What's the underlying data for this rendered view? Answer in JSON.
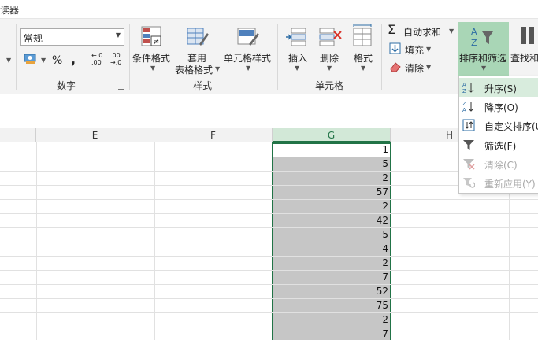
{
  "title_fragment": "读器",
  "ribbon": {
    "number_format": {
      "value": "常规",
      "percent": "%",
      "comma": ",",
      "inc_decimal": "←.0\n.00",
      "dec_decimal": ".00\n→.0",
      "group_label": "数字"
    },
    "styles": {
      "conditional": "条件格式",
      "table1": "套用",
      "table2": "表格格式",
      "cell_style": "单元格样式",
      "group_label": "样式"
    },
    "cells": {
      "insert": "插入",
      "delete": "删除",
      "format": "格式",
      "group_label": "单元格"
    },
    "editing": {
      "autosum": "自动求和",
      "fill": "填充",
      "clear": "清除",
      "sort_filter": "排序和筛选",
      "find_select": "查找和"
    }
  },
  "columns": [
    {
      "letter": "E",
      "selected": false
    },
    {
      "letter": "F",
      "selected": false
    },
    {
      "letter": "G",
      "selected": true
    },
    {
      "letter": "H",
      "selected": false
    }
  ],
  "column_g_values": [
    "1",
    "5",
    "2",
    "57",
    "2",
    "42",
    "5",
    "4",
    "2",
    "7",
    "52",
    "75",
    "2",
    "7"
  ],
  "sort_menu": {
    "items": [
      {
        "label": "升序(S)",
        "icon": "sort-ascending-icon",
        "active": true,
        "disabled": false
      },
      {
        "label": "降序(O)",
        "icon": "sort-descending-icon",
        "active": false,
        "disabled": false
      },
      {
        "label": "自定义排序(U)",
        "icon": "custom-sort-icon",
        "active": false,
        "disabled": false
      },
      {
        "label": "筛选(F)",
        "icon": "filter-icon",
        "active": false,
        "disabled": false
      },
      {
        "label": "清除(C)",
        "icon": "clear-filter-icon",
        "active": false,
        "disabled": true
      },
      {
        "label": "重新应用(Y)",
        "icon": "reapply-icon",
        "active": false,
        "disabled": true
      }
    ]
  },
  "colors": {
    "accent": "#217346",
    "selection_fill": "#c6c6c6",
    "sort_button_bg": "#a9d6b6"
  }
}
